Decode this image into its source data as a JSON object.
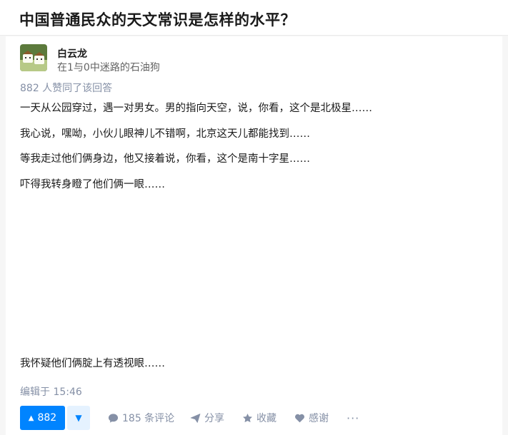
{
  "question": {
    "title": "中国普通民众的天文常识是怎样的水平？"
  },
  "author": {
    "name": "白云龙",
    "bio": "在1与0中迷路的石油狗"
  },
  "answer": {
    "vote_summary": "882 人赞同了该回答",
    "paragraphs": [
      "一天从公园穿过，遇一对男女。男的指向天空，说，你看，这个是北极星……",
      "我心说，嘿呦，小伙儿眼神儿不错啊，北京这天儿都能找到……",
      "等我走过他们俩身边，他又接着说，你看，这个是南十字星……",
      "吓得我转身瞪了他们俩一眼……",
      "我怀疑他们俩腚上有透视眼……"
    ],
    "edit_time": "编辑于 15:46"
  },
  "actions": {
    "upvote_count": "882",
    "upvote_glyph": "▲",
    "downvote_glyph": "▼",
    "comment_label": "185 条评论",
    "share_label": "分享",
    "collect_label": "收藏",
    "thanks_label": "感谢",
    "more_label": "···"
  },
  "colors": {
    "accent": "#0084ff",
    "accent_light": "#e5f2ff",
    "meta_text": "#8590a6"
  }
}
